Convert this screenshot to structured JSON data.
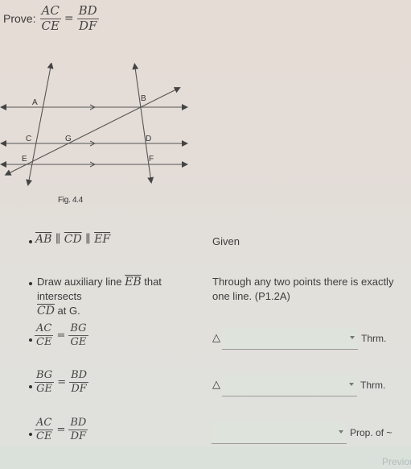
{
  "prove": {
    "label": "Prove:",
    "lhs": {
      "num": "AC",
      "den": "CE"
    },
    "eq": "=",
    "rhs": {
      "num": "BD",
      "den": "DF"
    }
  },
  "figure": {
    "caption": "Fig. 4.4",
    "points": {
      "A": "A",
      "B": "B",
      "C": "C",
      "D": "D",
      "E": "E",
      "F": "F",
      "G": "G"
    }
  },
  "proof": {
    "steps": [
      {
        "statement": {
          "seg1": "AB",
          "par1": "∥",
          "seg2": "CD",
          "par2": "∥",
          "seg3": "EF"
        },
        "reason": "Given"
      },
      {
        "statement": {
          "pre": "Draw auxiliary line ",
          "seg": "EB",
          "mid": " that intersects",
          "seg2": "CD",
          "post": " at G."
        },
        "reason": "Through any two points there is exactly one line. (P1.2A)"
      },
      {
        "statement": {
          "lhs": {
            "num": "AC",
            "den": "CE"
          },
          "eq": "=",
          "rhs": {
            "num": "BG",
            "den": "GE"
          }
        },
        "reason": {
          "prefix": "△",
          "selected": "",
          "suffix": "Thrm."
        }
      },
      {
        "statement": {
          "lhs": {
            "num": "BG",
            "den": "GE"
          },
          "eq": "=",
          "rhs": {
            "num": "BD",
            "den": "DF"
          }
        },
        "reason": {
          "prefix": "△",
          "selected": "",
          "suffix": "Thrm."
        }
      },
      {
        "statement": {
          "lhs": {
            "num": "AC",
            "den": "CE"
          },
          "eq": "=",
          "rhs": {
            "num": "BD",
            "den": "DF"
          }
        },
        "reason": {
          "prefix": "",
          "selected": "",
          "suffix": "Prop. of ~"
        }
      }
    ]
  },
  "nav": {
    "previous_label": "Previous"
  }
}
